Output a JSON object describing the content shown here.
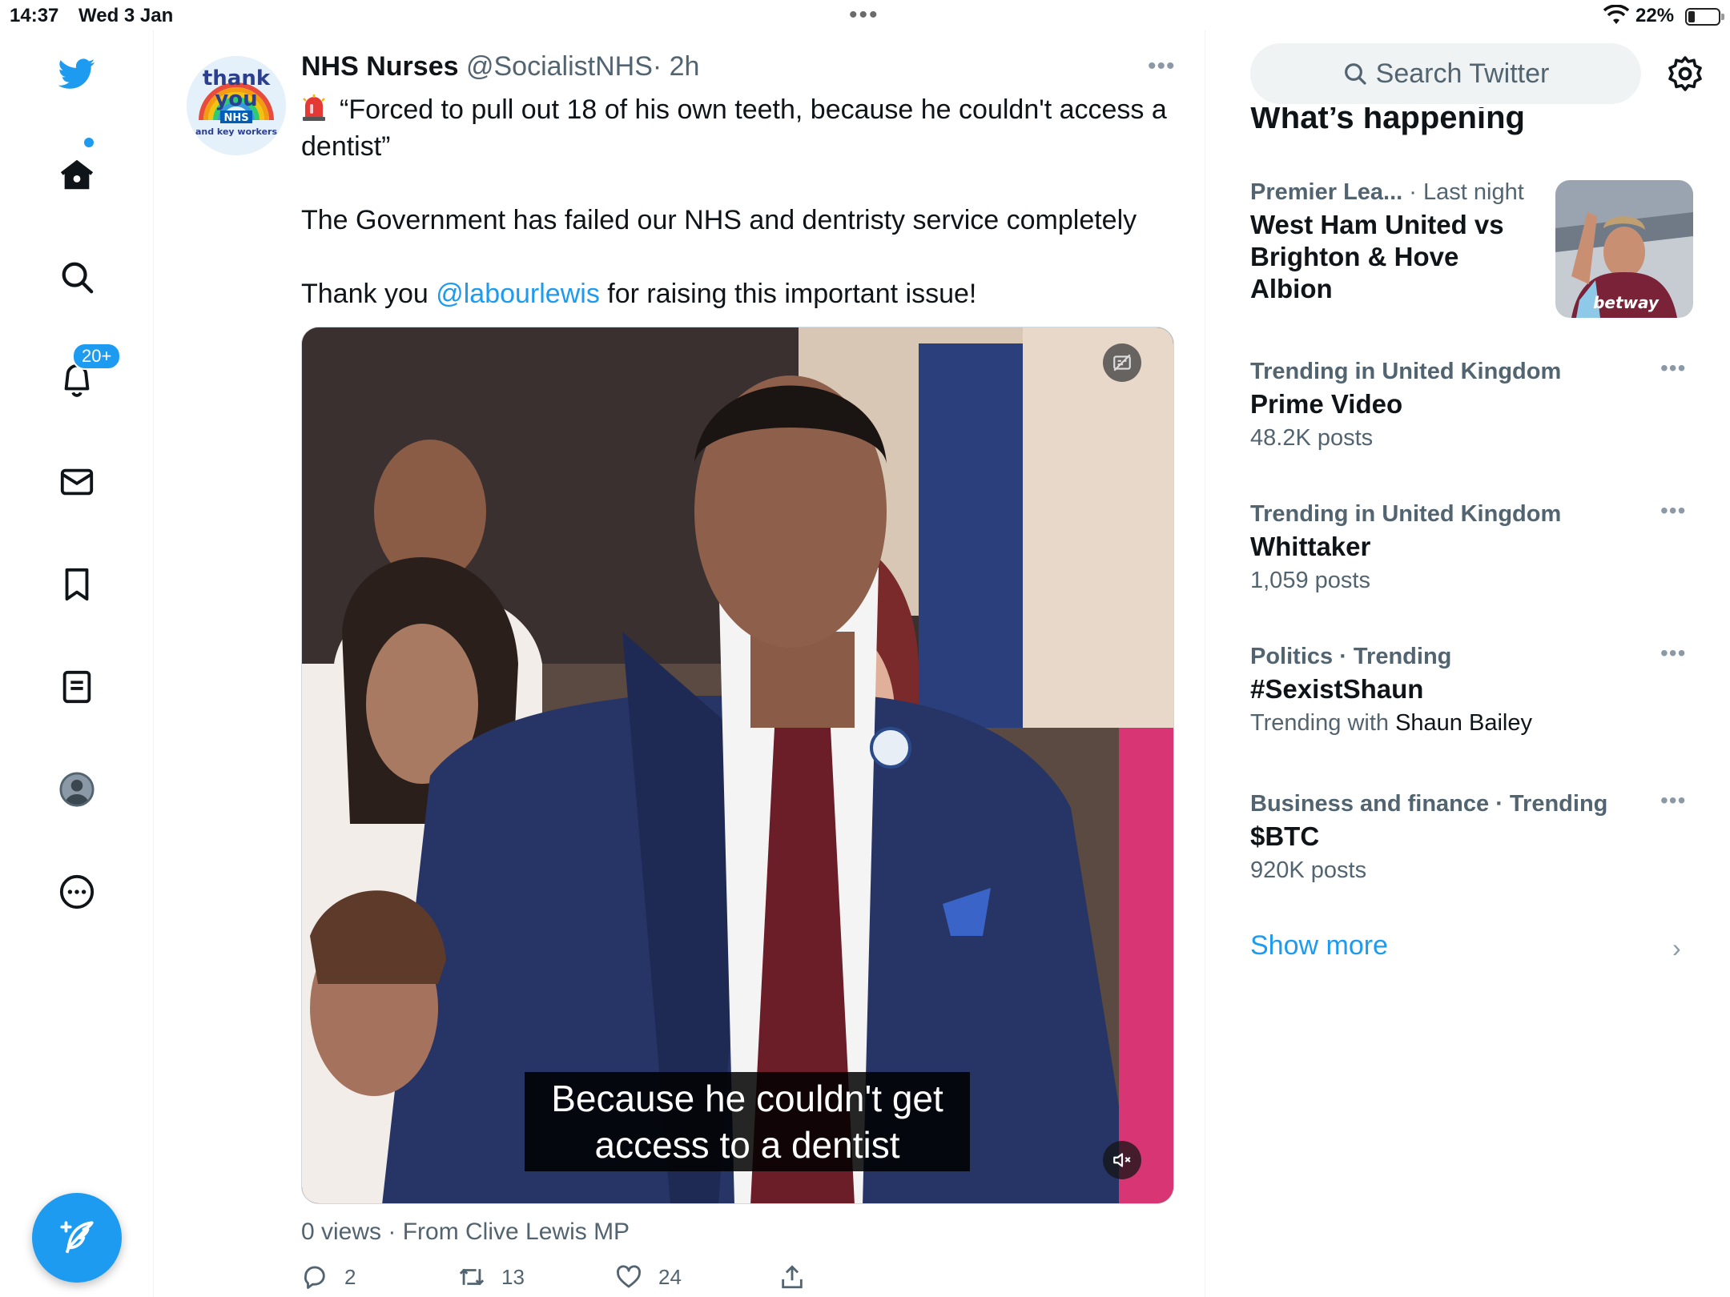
{
  "status_bar": {
    "time": "14:37",
    "date": "Wed 3 Jan",
    "battery": "22%"
  },
  "nav": {
    "notifications_badge": "20+"
  },
  "tweet": {
    "name": "NHS Nurses",
    "handle": "@SocialistNHS",
    "time": "· 2h",
    "line1": "“Forced to pull out 18 of his own teeth, because he couldn't access a dentist”",
    "line2": "The Government has failed our NHS and dentristy service completely",
    "line3_pre": "Thank you ",
    "mention": "@labourlewis",
    "line3_post": " for raising this important issue!",
    "avatar_text_1": "thank",
    "avatar_text_2": "you",
    "avatar_text_3": "NHS",
    "avatar_text_4": "and key workers",
    "video_subtitle": "Because he couldn't get access to a dentist",
    "views": "0 views · From Clive Lewis MP",
    "replies": "2",
    "retweets": "13",
    "likes": "24"
  },
  "sidebar": {
    "search_placeholder": "Search Twitter",
    "section_title": "What’s happening",
    "trends": [
      {
        "meta_a": "Premier Lea...",
        "meta_b": "· Last night",
        "title": "West Ham United vs Brighton & Hove Albion",
        "sub": ""
      },
      {
        "meta_a": "Trending in United Kingdom",
        "meta_b": "",
        "title": "Prime Video",
        "sub": "48.2K posts"
      },
      {
        "meta_a": "Trending in United Kingdom",
        "meta_b": "",
        "title": "Whittaker",
        "sub": "1,059 posts"
      },
      {
        "meta_a": "Politics",
        "meta_b": "· Trending",
        "title": "#SexistShaun",
        "sub_pre": "Trending with ",
        "sub_strong": "Shaun Bailey"
      },
      {
        "meta_a": "Business and finance",
        "meta_b": "· Trending",
        "title": "$BTC",
        "sub": "920K posts"
      }
    ],
    "show_more": "Show more",
    "trend_image_text": "betway"
  },
  "colors": {
    "accent": "#1d9bf0",
    "text": "#0f1419",
    "muted": "#536471"
  }
}
